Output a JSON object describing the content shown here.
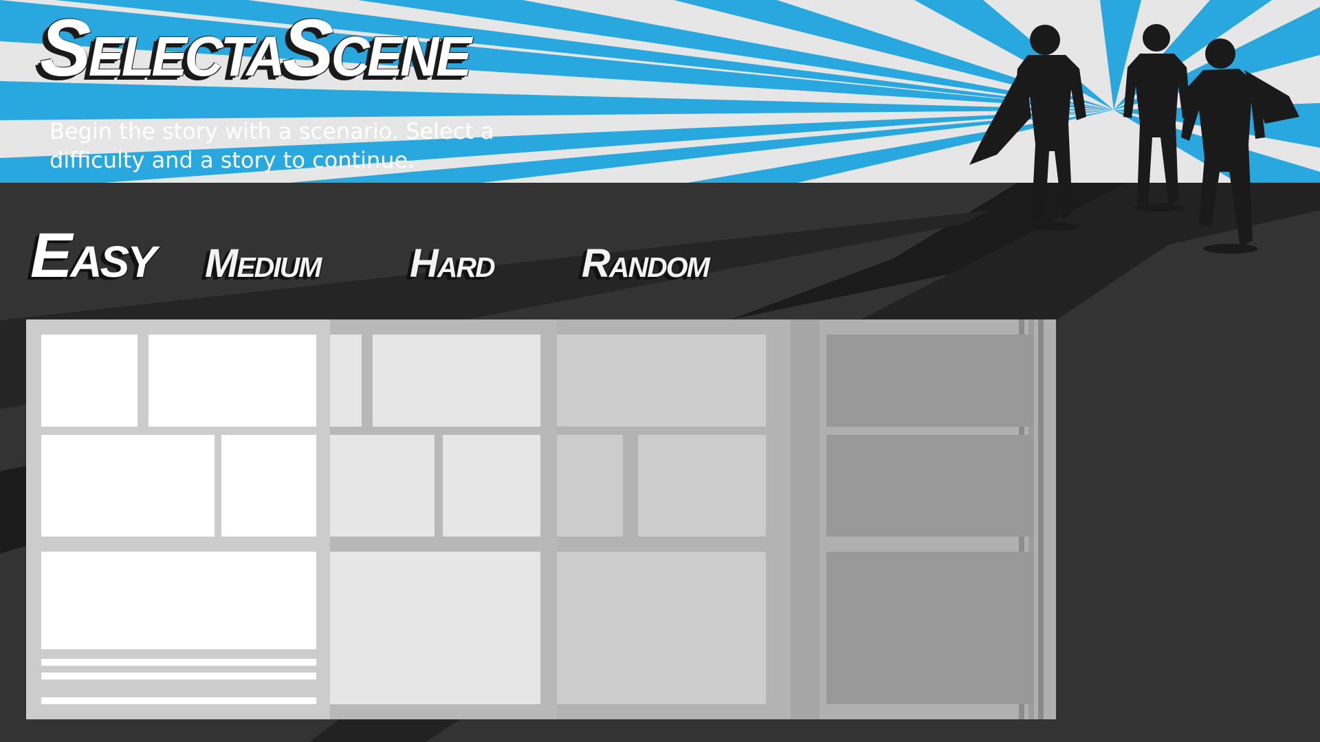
{
  "header": {
    "title": "SelectaScene",
    "subtitle": "Begin the story with a scenario. Select a difficulty and a story to continue."
  },
  "difficulty_tabs": [
    {
      "label": "Easy",
      "selected": true
    },
    {
      "label": "Medium",
      "selected": false
    },
    {
      "label": "Hard",
      "selected": false
    },
    {
      "label": "Random",
      "selected": false
    }
  ],
  "colors": {
    "sky_blue": "#29a8e0",
    "sky_light": "#e6e6e6",
    "ground": "#333333",
    "shadow": "#1b1b1b",
    "silhouette": "#1a1a1a"
  },
  "scene_cards_icon": "comic-page-layout-icon"
}
